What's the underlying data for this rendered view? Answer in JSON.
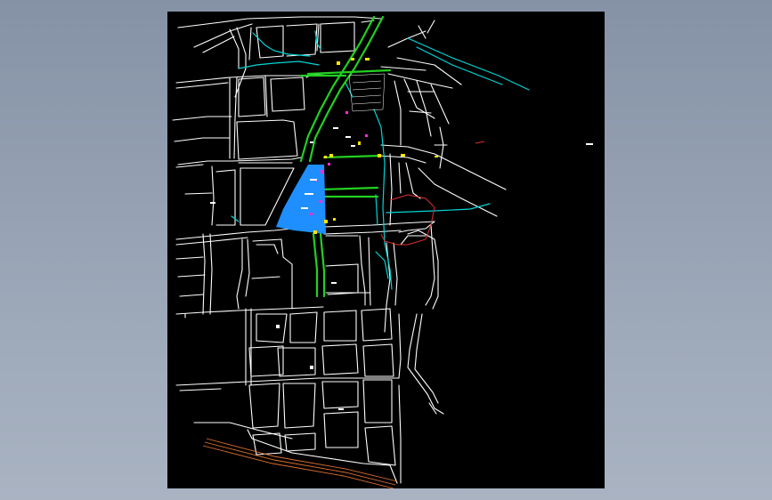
{
  "drawing": {
    "background_color": "#000000",
    "layers": [
      {
        "name": "roads",
        "color": "#ffffff"
      },
      {
        "name": "water",
        "color": "#00d6d6"
      },
      {
        "name": "main-corridor",
        "color": "#22d022"
      },
      {
        "name": "development-area",
        "color": "#1f8fff"
      },
      {
        "name": "markers-yellow",
        "color": "#ffe600"
      },
      {
        "name": "markers-magenta",
        "color": "#ff2bd6"
      },
      {
        "name": "boundary",
        "color": "#e03030"
      },
      {
        "name": "railway",
        "color": "#e07030"
      }
    ]
  }
}
